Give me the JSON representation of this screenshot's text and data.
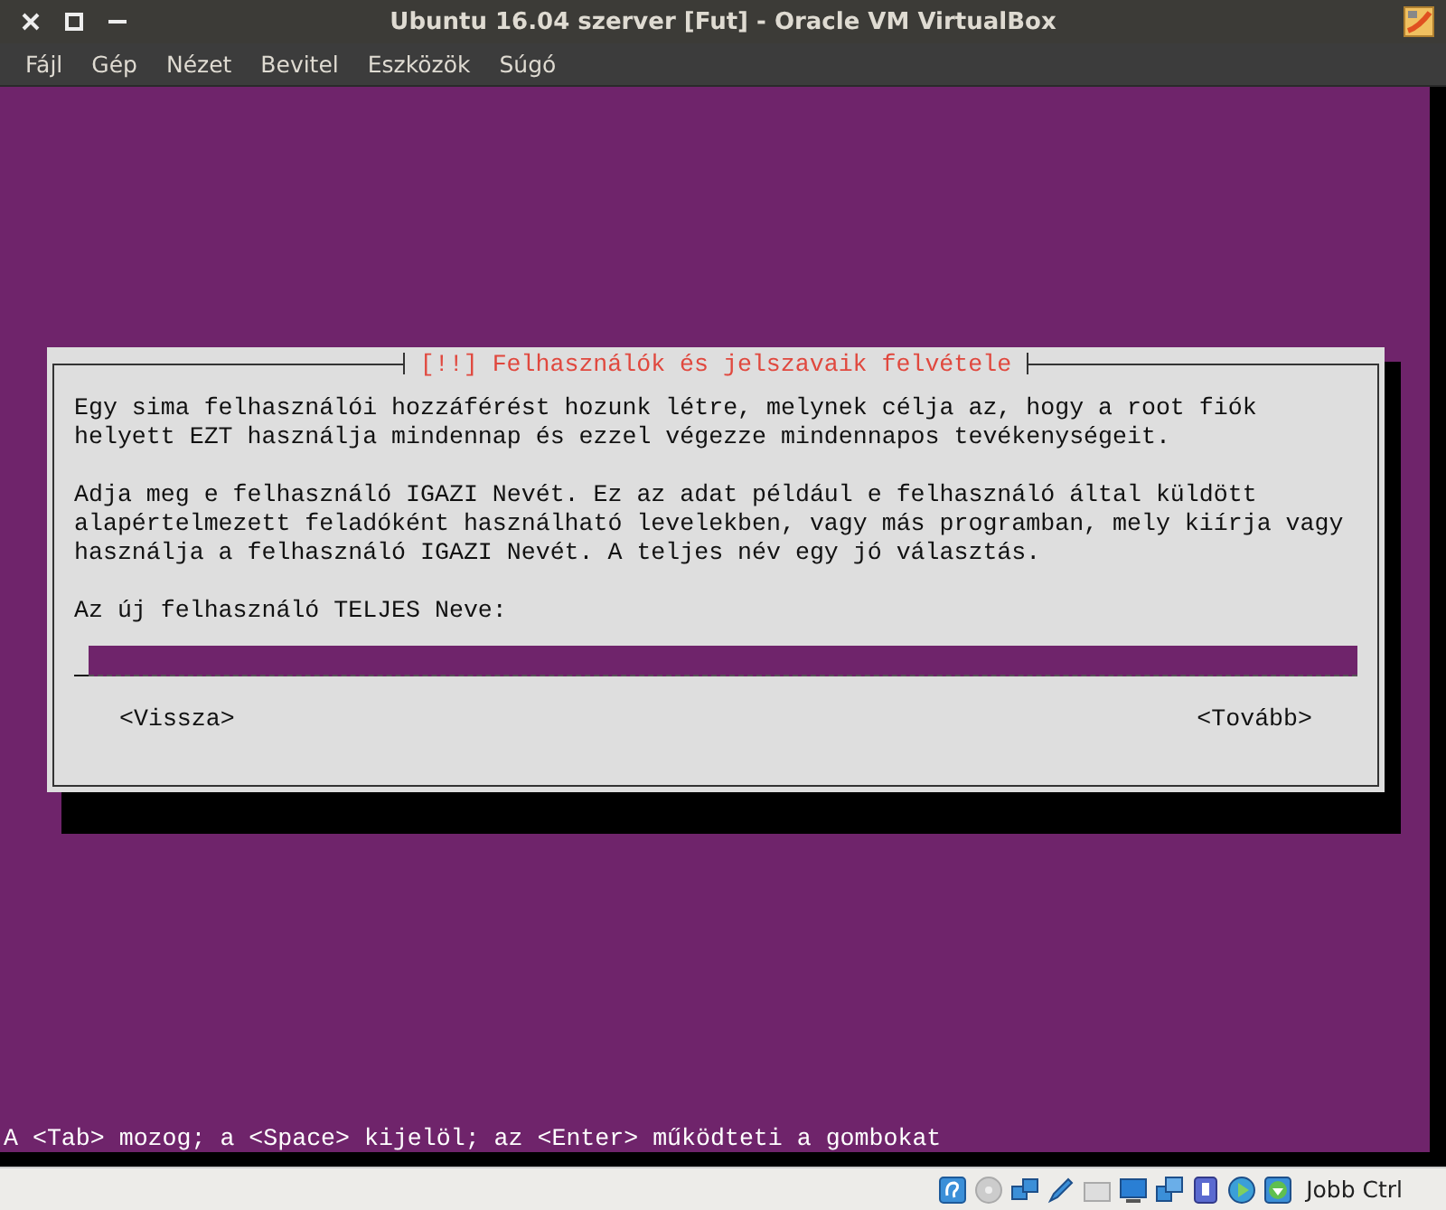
{
  "window": {
    "title": "Ubuntu 16.04 szerver [Fut] - Oracle VM VirtualBox"
  },
  "menu": [
    "Fájl",
    "Gép",
    "Nézet",
    "Bevitel",
    "Eszközök",
    "Súgó"
  ],
  "dialog": {
    "title": "[!!] Felhasználók és jelszavaik felvétele",
    "paragraphs": [
      [
        "Egy sima felhasználói hozzáférést hozunk létre, melynek célja az, hogy a root fiók",
        "helyett EZT használja mindennap és ezzel végezze mindennapos tevékenységeit."
      ],
      [
        "Adja meg e felhasználó IGAZI Nevét. Ez az adat például e felhasználó által küldött",
        "alapértelmezett feladóként használható levelekben, vagy más programban, mely kiírja vagy",
        "használja a felhasználó IGAZI Nevét. A teljes név egy jó választás."
      ]
    ],
    "field_label": "Az új felhasználó TELJES Neve:",
    "buttons": [
      "<Vissza>",
      "<Tovább>"
    ]
  },
  "console_hint": "A <Tab> mozog; a <Space> kijelöl; az <Enter> működteti a gombokat",
  "status_bar": {
    "host_key": "Jobb Ctrl"
  }
}
